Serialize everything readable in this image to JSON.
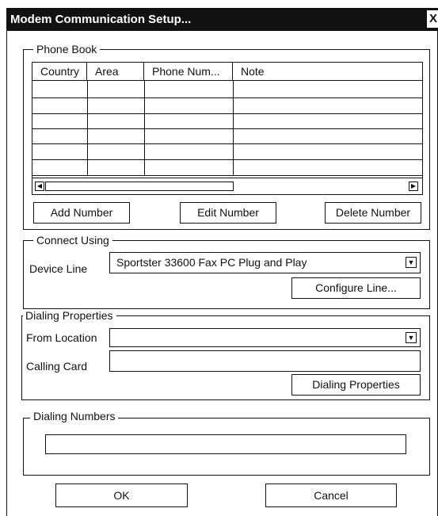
{
  "window": {
    "title": "Modem Communication Setup...",
    "close_label": "X"
  },
  "phone_book": {
    "legend": "Phone Book",
    "columns": [
      "Country",
      "Area",
      "Phone Num...",
      "Note"
    ],
    "rows": [
      [
        "",
        "",
        "",
        ""
      ],
      [
        "",
        "",
        "",
        ""
      ],
      [
        "",
        "",
        "",
        ""
      ],
      [
        "",
        "",
        "",
        ""
      ],
      [
        "",
        "",
        "",
        ""
      ],
      [
        "",
        "",
        "",
        ""
      ]
    ],
    "buttons": {
      "add": "Add Number",
      "edit": "Edit Number",
      "delete": "Delete Number"
    },
    "scroll_left_icon": "scroll-left-arrow",
    "scroll_right_icon": "scroll-right-arrow"
  },
  "connect_using": {
    "legend": "Connect Using",
    "device_label": "Device Line",
    "device_value": "Sportster 33600 Fax PC Plug and Play",
    "configure_button": "Configure Line..."
  },
  "dialing_properties": {
    "legend": "Dialing Properties",
    "from_location_label": "From Location",
    "from_location_value": "",
    "calling_card_label": "Calling Card",
    "calling_card_value": "",
    "button": "Dialing Properties"
  },
  "dialing_numbers": {
    "legend": "Dialing Numbers",
    "value": ""
  },
  "footer": {
    "ok": "OK",
    "cancel": "Cancel"
  }
}
